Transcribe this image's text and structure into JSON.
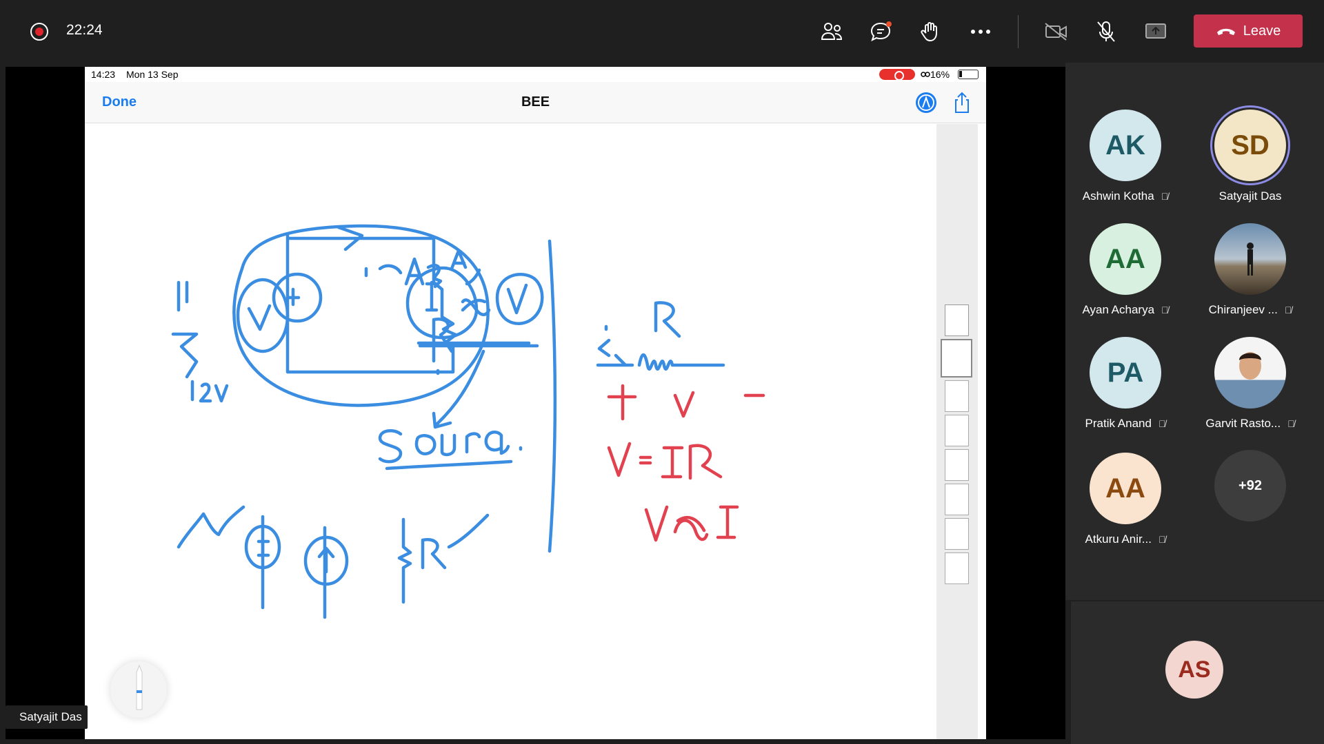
{
  "topbar": {
    "timer": "22:24",
    "leave_label": "Leave",
    "icons": [
      "recording-icon",
      "people-icon",
      "chat-icon",
      "raise-hand-icon",
      "more-icon",
      "camera-off-icon",
      "mic-off-icon",
      "share-icon",
      "phone-icon"
    ]
  },
  "ipad": {
    "time": "14:23",
    "date": "Mon 13 Sep",
    "battery": "16%",
    "done_label": "Done",
    "doc_title": "BEE",
    "pages_shown": 8
  },
  "presenter_name": "Satyajit Das",
  "participants": [
    {
      "initials": "AK",
      "name": "Ashwin Kotha",
      "muted": true
    },
    {
      "initials": "SD",
      "name": "Satyajit Das",
      "muted": false
    },
    {
      "initials": "AA",
      "name": "Ayan Acharya",
      "muted": true
    },
    {
      "initials": "",
      "name": "Chiranjeev ...",
      "muted": true
    },
    {
      "initials": "PA",
      "name": "Pratik Anand",
      "muted": true
    },
    {
      "initials": "",
      "name": "Garvit Rasto...",
      "muted": true
    },
    {
      "initials": "AA",
      "name": "Atkuru Anir...",
      "muted": true
    }
  ],
  "overflow_count": "+92",
  "self_initials": "AS",
  "colors": {
    "leave": "#c4314b",
    "ink_blue": "#3a8de0",
    "ink_red": "#e2414f",
    "ios_blue": "#1b7cf0"
  }
}
